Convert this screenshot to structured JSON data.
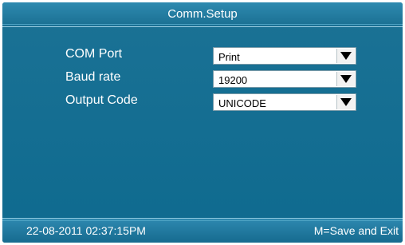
{
  "screen": {
    "title": "Comm.Setup"
  },
  "settings": [
    {
      "label": "COM Port",
      "value": "Print",
      "icon": "chevron-down-icon"
    },
    {
      "label": "Baud rate",
      "value": "19200",
      "icon": "chevron-down-icon"
    },
    {
      "label": "Output Code",
      "value": "UNICODE",
      "icon": "chevron-down-icon"
    }
  ],
  "status_bar": {
    "datetime": "22-08-2011  02:37:15PM",
    "hint": "M=Save and Exit"
  },
  "colors": {
    "background": "#0e6a8f",
    "bar": "#1a6f92",
    "text": "#ffffff",
    "field": "#ffffff"
  }
}
